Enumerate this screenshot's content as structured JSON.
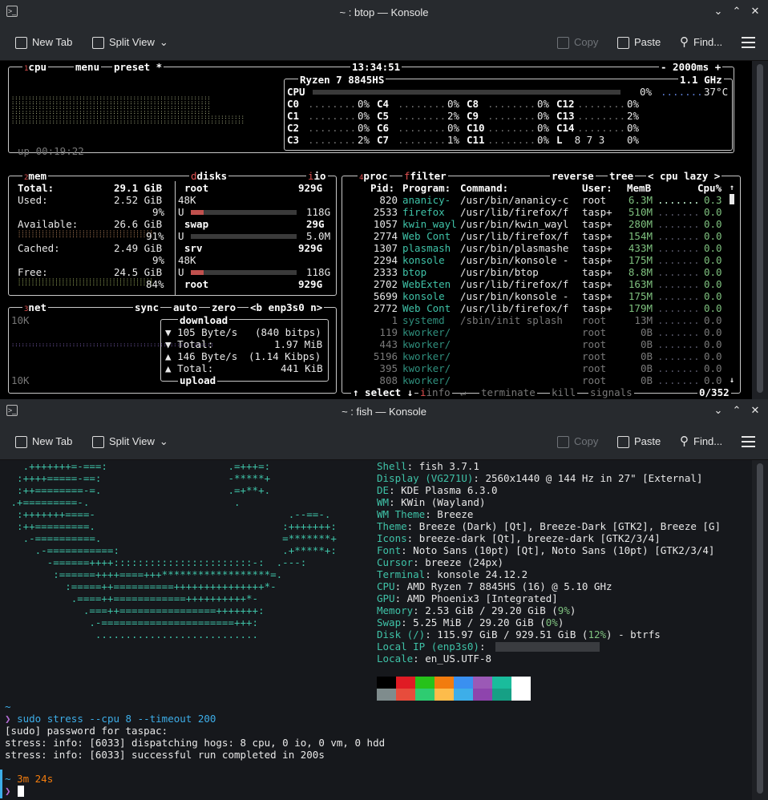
{
  "btop_win": {
    "title": "~ : btop — Konsole"
  },
  "fish_win": {
    "title": "~ : fish — Konsole"
  },
  "toolbar": {
    "new_tab": "New Tab",
    "split_view": "Split View",
    "copy": "Copy",
    "paste": "Paste",
    "find": "Find..."
  },
  "btop": {
    "cpu_box": {
      "sup": "1",
      "label": "cpu",
      "menu": "menu",
      "preset": "preset *",
      "clock": "13:34:51",
      "interval": "- 2000ms +",
      "uptime": "up 00:19:22",
      "model": "Ryzen 7 8845HS",
      "freq": "1.1 GHz",
      "total_label": "CPU",
      "total_pct": "0%",
      "temp": "37°C",
      "cores": [
        [
          "C0",
          "0%"
        ],
        [
          "C1",
          "0%"
        ],
        [
          "C2",
          "0%"
        ],
        [
          "C3",
          "2%"
        ],
        [
          "C4",
          "0%"
        ],
        [
          "C5",
          "2%"
        ],
        [
          "C6",
          "0%"
        ],
        [
          "C7",
          "1%"
        ],
        [
          "C8",
          "0%"
        ],
        [
          "C9",
          "0%"
        ],
        [
          "C10",
          "0%"
        ],
        [
          "C11",
          "0%"
        ],
        [
          "C12",
          "0%"
        ],
        [
          "C13",
          "2%"
        ],
        [
          "C14",
          "0%"
        ]
      ],
      "load_label": "L",
      "load_values": "8 7 3",
      "load_pct": "0%"
    },
    "mem_box": {
      "sup": "2",
      "label": "mem",
      "total_label": "Total:",
      "total": "29.1 GiB",
      "used_label": "Used:",
      "used": "2.52 GiB",
      "used_pct": "9%",
      "avail_label": "Available:",
      "avail": "26.6 GiB",
      "avail_pct": "91%",
      "cached_label": "Cached:",
      "cached": "2.49 GiB",
      "cached_pct": "9%",
      "free_label": "Free:",
      "free": "24.5 GiB",
      "free_pct": "84%"
    },
    "disks": {
      "label": "disks",
      "io": "io",
      "root1": "root",
      "root1_size": "929G",
      "root1_used": "48K",
      "root1_free": "118G",
      "swap": "swap",
      "swap_size": "29G",
      "swap_free": "5.0M",
      "srv": "srv",
      "srv_size": "929G",
      "srv_used": "48K",
      "srv_free": "118G",
      "root2": "root",
      "root2_size": "929G",
      "u_label": "U"
    },
    "net_box": {
      "sup": "3",
      "label": "net",
      "sync": "sync",
      "auto": "auto",
      "zero": "zero",
      "iface": "<b enp3s0 n>",
      "top_scale": "10K",
      "bottom_scale": "10K",
      "download": "download",
      "dl_rate": "105 Byte/s",
      "dl_bits": "(840 bitps)",
      "dl_total_label": "Total:",
      "dl_total": "1.97 MiB",
      "ul_rate": "146 Byte/s",
      "ul_bits": "(1.14 Kibps)",
      "ul_total_label": "Total:",
      "ul_total": "441 KiB",
      "upload": "upload",
      "down_arrow": "▼",
      "up_arrow": "▲"
    },
    "proc_box": {
      "sup": "4",
      "label": "proc",
      "filter": "filter",
      "reverse": "reverse",
      "tree": "tree",
      "sort": "< cpu lazy >",
      "col_pid": "Pid:",
      "col_prog": "Program:",
      "col_cmd": "Command:",
      "col_user": "User:",
      "col_mem": "MemB",
      "col_cpu": "Cpu%",
      "rows": [
        [
          "820",
          "ananicy-",
          "/usr/bin/ananicy-c",
          "root",
          "6.3M",
          "0.3"
        ],
        [
          "2533",
          "firefox",
          "/usr/lib/firefox/f",
          "tasp+",
          "510M",
          "0.0"
        ],
        [
          "1057",
          "kwin_wayl",
          "/usr/bin/kwin_wayl",
          "tasp+",
          "280M",
          "0.0"
        ],
        [
          "2774",
          "Web Cont",
          "/usr/lib/firefox/f",
          "tasp+",
          "154M",
          "0.0"
        ],
        [
          "1307",
          "plasmash",
          "/usr/bin/plasmashe",
          "tasp+",
          "433M",
          "0.0"
        ],
        [
          "2294",
          "konsole",
          "/usr/bin/konsole -",
          "tasp+",
          "175M",
          "0.0"
        ],
        [
          "2333",
          "btop",
          "/usr/bin/btop",
          "tasp+",
          "8.8M",
          "0.0"
        ],
        [
          "2702",
          "WebExten",
          "/usr/lib/firefox/f",
          "tasp+",
          "163M",
          "0.0"
        ],
        [
          "5699",
          "konsole",
          "/usr/bin/konsole -",
          "tasp+",
          "175M",
          "0.0"
        ],
        [
          "2772",
          "Web Cont",
          "/usr/lib/firefox/f",
          "tasp+",
          "179M",
          "0.0"
        ],
        [
          "1",
          "systemd",
          "/sbin/init splash",
          "root",
          "13M",
          "0.0"
        ],
        [
          "119",
          "kworker/",
          "",
          "root",
          "0B",
          "0.0"
        ],
        [
          "443",
          "kworker/",
          "",
          "root",
          "0B",
          "0.0"
        ],
        [
          "5196",
          "kworker/",
          "",
          "root",
          "0B",
          "0.0"
        ],
        [
          "395",
          "kworker/",
          "",
          "root",
          "0B",
          "0.0"
        ],
        [
          "808",
          "kworker/",
          "",
          "root",
          "0B",
          "0.0"
        ]
      ],
      "select": "↑ select ↓",
      "info": "info",
      "terminate": "terminate",
      "kill": "kill",
      "signals": "signals",
      "count": "0/352",
      "enter": "↵"
    }
  },
  "fish": {
    "logo": [
      "   .+++++++=-===:                    .=+++=:",
      "  :++++=====-==:                     -*****+",
      "  :++========-=.                     .=+**+.",
      " .+=========-.                        .",
      "  :+++++++====-                                .--==-.",
      "  :++=========.                               :+++++++:",
      "   .-==========.                              =*******+",
      "     .-===========:                           .+*****+:",
      "       -======++++:::::::::::::::::::::::-:  .---:",
      "        :======++++====+++******************=.",
      "          :=====++==========+++++++++++++++*-",
      "           .====++============++++++++++*-",
      "             .===++================+++++++:",
      "              .-======================+++:",
      "               ..........................."
    ],
    "info": [
      {
        "k": "Shell",
        "v": "fish 3.7.1"
      },
      {
        "k": "Display (VG271U)",
        "v": "2560x1440 @ 144 Hz in 27\" [External]"
      },
      {
        "k": "DE",
        "v": "KDE Plasma 6.3.0"
      },
      {
        "k": "WM",
        "v": "KWin (Wayland)"
      },
      {
        "k": "WM Theme",
        "v": "Breeze"
      },
      {
        "k": "Theme",
        "v": "Breeze (Dark) [Qt], Breeze-Dark [GTK2], Breeze [G]"
      },
      {
        "k": "Icons",
        "v": "breeze-dark [Qt], breeze-dark [GTK2/3/4]"
      },
      {
        "k": "Font",
        "v": "Noto Sans (10pt) [Qt], Noto Sans (10pt) [GTK2/3/4]"
      },
      {
        "k": "Cursor",
        "v": "breeze (24px)"
      },
      {
        "k": "Terminal",
        "v": "konsole 24.12.2"
      },
      {
        "k": "CPU",
        "v": "AMD Ryzen 7 8845HS (16) @ 5.10 GHz"
      },
      {
        "k": "GPU",
        "v": "AMD Phoenix3 [Integrated]"
      }
    ],
    "mem_k": "Memory",
    "mem_v1": "2.53 GiB / 29.20 GiB (",
    "mem_p": "9%",
    "mem_v2": ")",
    "swap_k": "Swap",
    "swap_v1": "5.25 MiB / 29.20 GiB (",
    "swap_p": "0%",
    "swap_v2": ")",
    "disk_k": "Disk (/)",
    "disk_v1": "115.97 GiB / 929.51 GiB (",
    "disk_p": "12%",
    "disk_v2": ") - btrfs",
    "ip_k": "Local IP (enp3s0)",
    "locale_k": "Locale",
    "locale_v": "en_US.UTF-8",
    "palette_top": [
      "#000000",
      "#e01b24",
      "#26c21a",
      "#f27c0e",
      "#3a90f0",
      "#9b59b6",
      "#1abc9c",
      "#ffffff"
    ],
    "palette_bottom": [
      "#7f8c8d",
      "#e74c3c",
      "#2ecc71",
      "#fdbc4b",
      "#3daee9",
      "#8e44ad",
      "#16a085",
      "#ffffff"
    ],
    "prompt1": "~",
    "prompt_sym": "❯",
    "cmd": "sudo stress --cpu 8 --timeout 200",
    "out": [
      "[sudo] password for taspac:",
      "stress: info: [6033] dispatching hogs: 8 cpu, 0 io, 0 vm, 0 hdd",
      "stress: info: [6033] successful run completed in 200s"
    ],
    "duration_home": "~",
    "duration": "3m 24s"
  }
}
